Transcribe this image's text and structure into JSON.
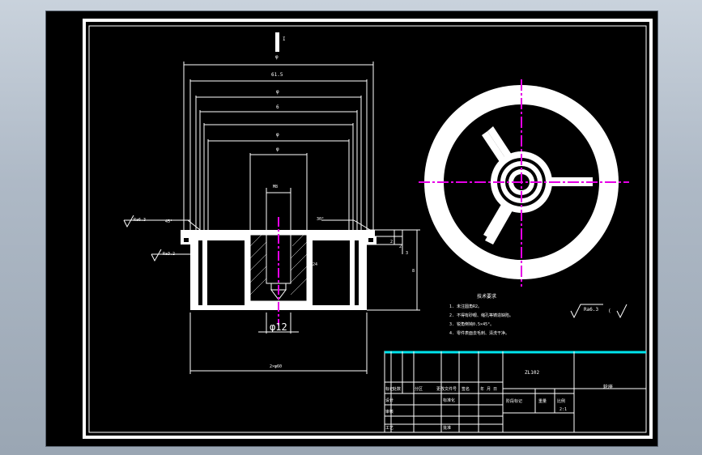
{
  "colors": {
    "background": "#000000",
    "geometry": "#ffffff",
    "centerline": "#e600e6",
    "title_accent": "#00e5ee"
  },
  "section_view": {
    "cut_marker": "I",
    "dim_top": "φ",
    "dim_615": "61.5",
    "dim_phi_2": "φ",
    "dim_6": "6",
    "dim_phi_3": "φ",
    "dim_phi_4": "φ",
    "dim_m": "M8",
    "dim_angle_left": "45°",
    "dim_angle_right": "30°",
    "rough_1": "Ra6.3",
    "rough_2": "Ra3.2",
    "dim_right_1": "2",
    "dim_right_2": "2",
    "dim_right_3": "3",
    "dim_right_4": "8",
    "dim_depth": "24",
    "dim_hole": "φ12",
    "dim_bottom": "2×φ60"
  },
  "tech_notes": {
    "heading": "技术要求",
    "items": [
      "1. 未注圆角R2。",
      "2. 不得有砂眼、缩孔等铸造缺陷。",
      "3. 锐角倒钝0.5×45°。",
      "4. 零件表面去毛刺、清洗干净。"
    ],
    "roughness_general": "Ra6.3"
  },
  "title_block": {
    "material": "ZL102",
    "part_name": "轮座",
    "row_headers": [
      "标记",
      "处数",
      "分区",
      "更改文件号",
      "签名",
      "年 月 日"
    ],
    "design": "设计",
    "standardize": "标准化",
    "review": "审核",
    "process": "工艺",
    "approve": "批准",
    "stage_mark": "阶段标记",
    "weight": "重量",
    "scale": "比例",
    "scale_value": "2:1"
  }
}
